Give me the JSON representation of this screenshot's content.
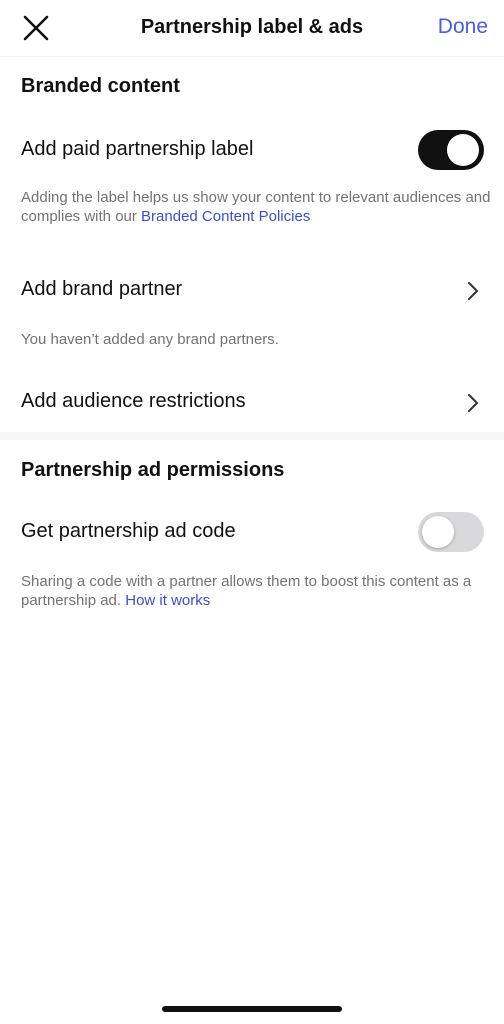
{
  "header": {
    "title": "Partnership label & ads",
    "done_label": "Done",
    "close_icon": "close-icon"
  },
  "branded_content": {
    "heading": "Branded content",
    "paid_label_row": {
      "label": "Add paid partnership label",
      "toggle_on": true
    },
    "paid_label_helper": {
      "text": "Adding the label helps us show your content to relevant audiences and complies with our ",
      "link": "Branded Content Policies"
    },
    "brand_partner_row": {
      "label": "Add brand partner"
    },
    "brand_partner_helper": "You haven’t added any brand partners.",
    "audience_row": {
      "label": "Add audience restrictions"
    }
  },
  "partnership_ads": {
    "heading": "Partnership ad permissions",
    "ad_code_row": {
      "label": "Get partnership ad code",
      "toggle_on": false
    },
    "ad_code_helper": {
      "text": "Sharing a code with a partner allows them to boost this content as a partnership ad. ",
      "link": "How it works"
    }
  },
  "colors": {
    "accent": "#4a5ed8",
    "link": "#3b4fc8",
    "toggle_on": "#111111",
    "toggle_off": "#d9d9dd"
  }
}
